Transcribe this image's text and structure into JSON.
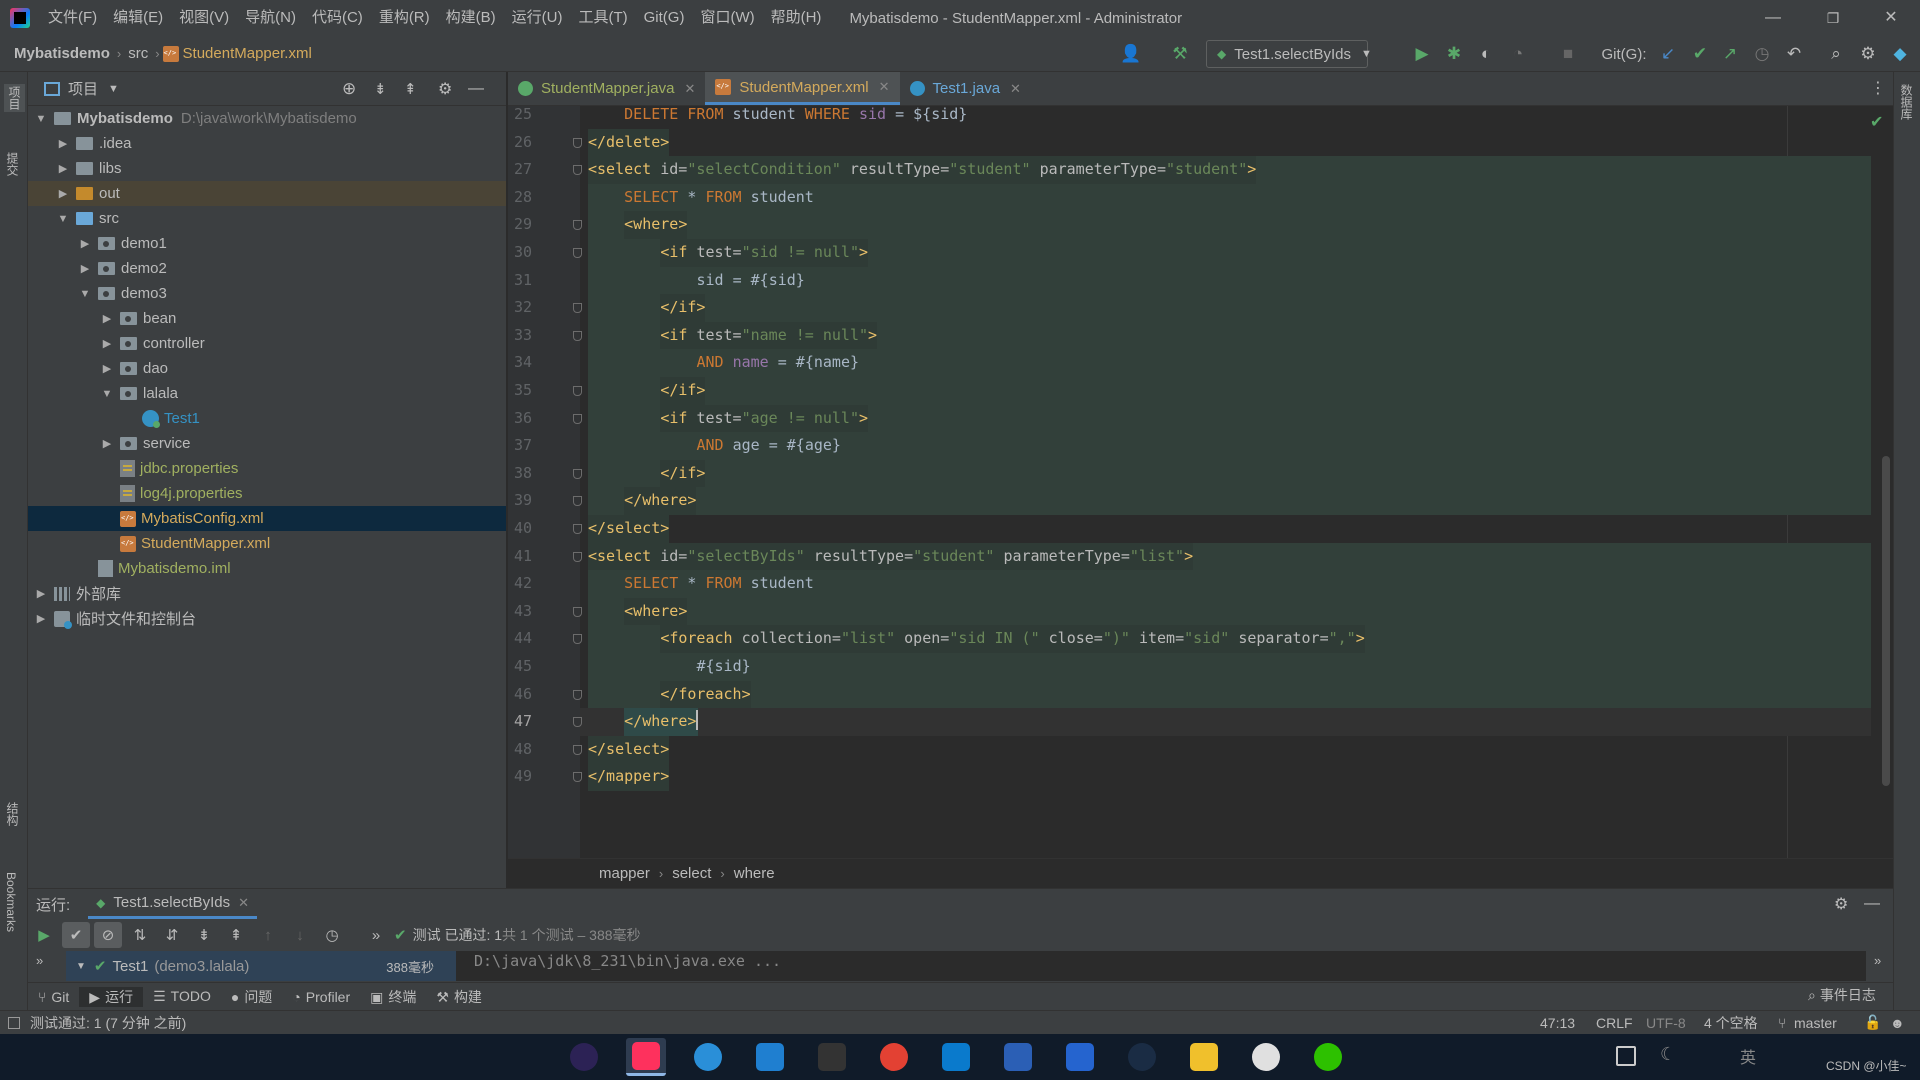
{
  "menubar": {
    "items": [
      "文件(F)",
      "编辑(E)",
      "视图(V)",
      "导航(N)",
      "代码(C)",
      "重构(R)",
      "构建(B)",
      "运行(U)",
      "工具(T)",
      "Git(G)",
      "窗口(W)",
      "帮助(H)"
    ],
    "window_title": "Mybatisdemo - StudentMapper.xml - Administrator",
    "minimize": "—",
    "restore": "❐",
    "close": "✕"
  },
  "navbar": {
    "project": "Mybatisdemo",
    "src": "src",
    "file": "StudentMapper.xml",
    "run_config": "Test1.selectByIds",
    "git_label": "Git(G):"
  },
  "left_strip": {
    "project": "项目",
    "commit": "提交",
    "structure": "结构",
    "bookmarks": "Bookmarks"
  },
  "right_strip": {
    "database": "数据库"
  },
  "project_panel": {
    "title": "项目",
    "tree": [
      {
        "label": "Mybatisdemo",
        "hint": "D:\\java\\work\\Mybatisdemo",
        "indent": 0,
        "arrow": "open",
        "icon": "module"
      },
      {
        "label": ".idea",
        "indent": 1,
        "arrow": "closed",
        "icon": "folder"
      },
      {
        "label": "libs",
        "indent": 1,
        "arrow": "closed",
        "icon": "folder"
      },
      {
        "label": "out",
        "indent": 1,
        "arrow": "closed",
        "icon": "folder-orange"
      },
      {
        "label": "src",
        "indent": 1,
        "arrow": "open",
        "icon": "folder-blue"
      },
      {
        "label": "demo1",
        "indent": 2,
        "arrow": "closed",
        "icon": "package"
      },
      {
        "label": "demo2",
        "indent": 2,
        "arrow": "closed",
        "icon": "package"
      },
      {
        "label": "demo3",
        "indent": 2,
        "arrow": "open",
        "icon": "package"
      },
      {
        "label": "bean",
        "indent": 3,
        "arrow": "closed",
        "icon": "package"
      },
      {
        "label": "controller",
        "indent": 3,
        "arrow": "closed",
        "icon": "package"
      },
      {
        "label": "dao",
        "indent": 3,
        "arrow": "closed",
        "icon": "package"
      },
      {
        "label": "lalala",
        "indent": 3,
        "arrow": "open",
        "icon": "package"
      },
      {
        "label": "Test1",
        "indent": 4,
        "arrow": "none",
        "icon": "java"
      },
      {
        "label": "service",
        "indent": 3,
        "arrow": "closed",
        "icon": "package"
      },
      {
        "label": "jdbc.properties",
        "indent": 3,
        "arrow": "none",
        "icon": "properties"
      },
      {
        "label": "log4j.properties",
        "indent": 3,
        "arrow": "none",
        "icon": "properties"
      },
      {
        "label": "MybatisConfig.xml",
        "indent": 3,
        "arrow": "none",
        "icon": "xml",
        "selected": true
      },
      {
        "label": "StudentMapper.xml",
        "indent": 3,
        "arrow": "none",
        "icon": "xml"
      },
      {
        "label": "Mybatisdemo.iml",
        "indent": 2,
        "arrow": "none",
        "icon": "iml"
      },
      {
        "label": "外部库",
        "indent": 0,
        "arrow": "closed",
        "icon": "library"
      },
      {
        "label": "临时文件和控制台",
        "indent": 0,
        "arrow": "closed",
        "icon": "scratch"
      }
    ]
  },
  "tabs": [
    {
      "label": "StudentMapper.java",
      "active": false,
      "icon": "interface"
    },
    {
      "label": "StudentMapper.xml",
      "active": true,
      "icon": "xml"
    },
    {
      "label": "Test1.java",
      "active": false,
      "icon": "class"
    }
  ],
  "editor": {
    "current_line": 47,
    "lines": [
      {
        "n": 25,
        "indent": 2,
        "hl": false,
        "tokens": [
          [
            "kw",
            "DELETE FROM "
          ],
          [
            "sql",
            "student "
          ],
          [
            "kw",
            "WHERE "
          ],
          [
            "sf",
            "sid "
          ],
          [
            "sql",
            "= ${sid}"
          ]
        ]
      },
      {
        "n": 26,
        "indent": 0,
        "hl": false,
        "tokens": [
          [
            "tag",
            "</delete>"
          ]
        ]
      },
      {
        "n": 27,
        "indent": 0,
        "hl": true,
        "tokens": [
          [
            "tag",
            "<select "
          ],
          [
            "attr",
            "id="
          ],
          [
            "val",
            "\"selectCondition\" "
          ],
          [
            "attr",
            "resultType="
          ],
          [
            "val",
            "\"student\" "
          ],
          [
            "attr",
            "parameterType="
          ],
          [
            "val",
            "\"student\""
          ],
          [
            "tag",
            ">"
          ]
        ]
      },
      {
        "n": 28,
        "indent": 2,
        "hl": true,
        "tokens": [
          [
            "kw",
            "SELECT "
          ],
          [
            "sql",
            "* "
          ],
          [
            "kw",
            "FROM "
          ],
          [
            "sql",
            "student"
          ]
        ]
      },
      {
        "n": 29,
        "indent": 2,
        "hl": true,
        "tokens": [
          [
            "tag",
            "<where>"
          ]
        ]
      },
      {
        "n": 30,
        "indent": 4,
        "hl": true,
        "tokens": [
          [
            "tag",
            "<if "
          ],
          [
            "attr",
            "test="
          ],
          [
            "val",
            "\"sid != null\""
          ],
          [
            "tag",
            ">"
          ]
        ]
      },
      {
        "n": 31,
        "indent": 6,
        "hl": true,
        "tokens": [
          [
            "sql",
            "sid = #{sid}"
          ]
        ]
      },
      {
        "n": 32,
        "indent": 4,
        "hl": true,
        "tokens": [
          [
            "tag",
            "</if>"
          ]
        ]
      },
      {
        "n": 33,
        "indent": 4,
        "hl": true,
        "tokens": [
          [
            "tag",
            "<if "
          ],
          [
            "attr",
            "test="
          ],
          [
            "val",
            "\"name != null\""
          ],
          [
            "tag",
            ">"
          ]
        ]
      },
      {
        "n": 34,
        "indent": 6,
        "hl": true,
        "tokens": [
          [
            "kw",
            "AND "
          ],
          [
            "sf",
            "name "
          ],
          [
            "sql",
            "= #{name}"
          ]
        ]
      },
      {
        "n": 35,
        "indent": 4,
        "hl": true,
        "tokens": [
          [
            "tag",
            "</if>"
          ]
        ]
      },
      {
        "n": 36,
        "indent": 4,
        "hl": true,
        "tokens": [
          [
            "tag",
            "<if "
          ],
          [
            "attr",
            "test="
          ],
          [
            "val",
            "\"age != null\""
          ],
          [
            "tag",
            ">"
          ]
        ]
      },
      {
        "n": 37,
        "indent": 6,
        "hl": true,
        "tokens": [
          [
            "kw",
            "AND "
          ],
          [
            "sql",
            "age = #{age}"
          ]
        ]
      },
      {
        "n": 38,
        "indent": 4,
        "hl": true,
        "tokens": [
          [
            "tag",
            "</if>"
          ]
        ]
      },
      {
        "n": 39,
        "indent": 2,
        "hl": true,
        "tokens": [
          [
            "tag",
            "</where>"
          ]
        ]
      },
      {
        "n": 40,
        "indent": 0,
        "hl": false,
        "tokens": [
          [
            "tag",
            "</select>"
          ]
        ]
      },
      {
        "n": 41,
        "indent": 0,
        "hl": true,
        "tokens": [
          [
            "tag",
            "<select "
          ],
          [
            "attr",
            "id="
          ],
          [
            "val",
            "\"selectByIds\" "
          ],
          [
            "attr",
            "resultType="
          ],
          [
            "val",
            "\"student\" "
          ],
          [
            "attr",
            "parameterType="
          ],
          [
            "val",
            "\"list\""
          ],
          [
            "tag",
            ">"
          ]
        ]
      },
      {
        "n": 42,
        "indent": 2,
        "hl": true,
        "tokens": [
          [
            "kw",
            "SELECT "
          ],
          [
            "sql",
            "* "
          ],
          [
            "kw",
            "FROM "
          ],
          [
            "sql",
            "student"
          ]
        ]
      },
      {
        "n": 43,
        "indent": 2,
        "hl": true,
        "tokens": [
          [
            "tag",
            "<where>"
          ]
        ]
      },
      {
        "n": 44,
        "indent": 4,
        "hl": true,
        "tokens": [
          [
            "tag",
            "<foreach "
          ],
          [
            "attr",
            "collection="
          ],
          [
            "val",
            "\"list\" "
          ],
          [
            "attr",
            "open="
          ],
          [
            "val",
            "\"sid IN (\" "
          ],
          [
            "attr",
            "close="
          ],
          [
            "val",
            "\")\" "
          ],
          [
            "attr",
            "item="
          ],
          [
            "val",
            "\"sid\" "
          ],
          [
            "attr",
            "separator="
          ],
          [
            "val",
            "\",\""
          ],
          [
            "tag",
            ">"
          ]
        ]
      },
      {
        "n": 45,
        "indent": 6,
        "hl": true,
        "tokens": [
          [
            "sql",
            "#{sid}"
          ]
        ]
      },
      {
        "n": 46,
        "indent": 4,
        "hl": true,
        "tokens": [
          [
            "tag",
            "</foreach>"
          ]
        ]
      },
      {
        "n": 47,
        "indent": 2,
        "hl": false,
        "tokens": [
          [
            "tag",
            "</where>"
          ]
        ]
      },
      {
        "n": 48,
        "indent": 0,
        "hl": false,
        "tokens": [
          [
            "tag",
            "</select>"
          ]
        ]
      },
      {
        "n": 49,
        "indent": 0,
        "hl": false,
        "tokens": [
          [
            "tag",
            "</mapper>"
          ]
        ]
      }
    ]
  },
  "breadcrumb": [
    "mapper",
    "select",
    "where"
  ],
  "run_panel": {
    "label": "运行:",
    "tab": "Test1.selectByIds",
    "result_text": "测试 已通过: 1",
    "result_detail": "共 1 个测试 – 388毫秒",
    "tree_item": "Test1",
    "tree_item_pkg": "(demo3.lalala)",
    "tree_item_time": "388毫秒",
    "console_line": "D:\\java\\jdk\\8_231\\bin\\java.exe ..."
  },
  "tool_tabs": [
    {
      "label": "Git",
      "icon": "⑂"
    },
    {
      "label": "运行",
      "icon": "▶",
      "active": true
    },
    {
      "label": "TODO",
      "icon": "☰"
    },
    {
      "label": "问题",
      "icon": "●"
    },
    {
      "label": "Profiler",
      "icon": "◔"
    },
    {
      "label": "终端",
      "icon": "▣"
    },
    {
      "label": "构建",
      "icon": "⚒"
    }
  ],
  "event_log": "事件日志",
  "status_bar": {
    "message": "测试通过: 1 (7 分钟 之前)",
    "position": "47:13",
    "line_sep": "CRLF",
    "encoding": "UTF-8",
    "indent": "4 个空格",
    "branch": "master"
  },
  "taskbar": {
    "apps": [
      {
        "name": "eclipse-icon",
        "color": "#2c2255"
      },
      {
        "name": "intellij-icon",
        "color": "#fe315d",
        "active": true
      },
      {
        "name": "edge-icon",
        "color": "#2a8fd8"
      },
      {
        "name": "window-app-icon",
        "color": "#1f7fd0"
      },
      {
        "name": "terminal-icon",
        "color": "#333333"
      },
      {
        "name": "chrome-icon",
        "color": "#e34133"
      },
      {
        "name": "vscode-icon",
        "color": "#0a7acc"
      },
      {
        "name": "visio-icon",
        "color": "#2b5fb5"
      },
      {
        "name": "todo-icon",
        "color": "#2564cf"
      },
      {
        "name": "steam-icon",
        "color": "#1a2c44"
      },
      {
        "name": "file-explorer-icon",
        "color": "#f0c02c"
      },
      {
        "name": "panda-icon",
        "color": "#e0e0e0"
      },
      {
        "name": "wechat-icon",
        "color": "#2dc100"
      }
    ],
    "watermark": "CSDN @小佳~"
  },
  "colors": {
    "accent": "#4a88c7",
    "pass_green": "#59a869",
    "tag": "#e8bf6a",
    "string": "#6a8759",
    "keyword": "#cc7832"
  }
}
